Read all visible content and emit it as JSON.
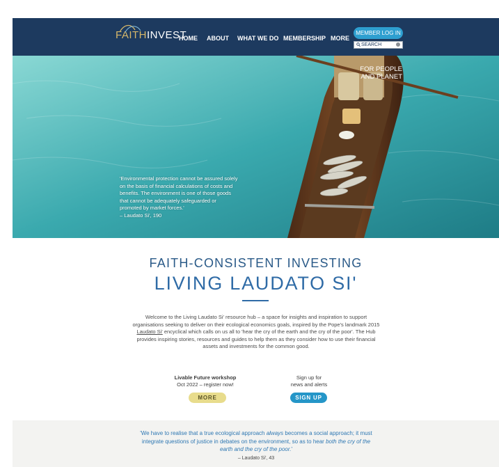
{
  "header": {
    "logo": {
      "part1": "FAITH",
      "part2": "INVEST"
    },
    "nav": [
      {
        "label": "HOME"
      },
      {
        "label": "ABOUT"
      },
      {
        "label": "WHAT WE DO"
      },
      {
        "label": "MEMBERSHIP"
      },
      {
        "label": "MORE"
      }
    ],
    "member_login_label": "MEMBER LOG IN",
    "search_placeholder": "SEARCH"
  },
  "hero": {
    "tagline_line1": "FOR PEOPLE",
    "tagline_line2": "AND PLANET",
    "quote_text": "'Environmental protection cannot be assured solely on the basis of financial calculations of costs and benefits. The environment is one of those goods that cannot be adequately safeguarded or promoted by market forces.'",
    "quote_cite": "– Laudato Si', 190"
  },
  "main": {
    "kicker": "FAITH-CONSISTENT INVESTING",
    "title": "LIVING LAUDATO SI'",
    "intro_before": "Welcome to the Living Laudato Si' resource hub – a space for insights and inspiration to support organisations seeking to deliver on their ecological economics goals, inspired by the Pope's landmark 2015 ",
    "intro_link": "Laudato Si'",
    "intro_after": " encyclical which calls on us all to 'hear the cry of the earth and the cry of the poor'. The Hub provides inspiring stories, resources and guides to help them as they consider how to use their financial assets and investments for the common good."
  },
  "cta": {
    "left_line1": "Livable Future workshop",
    "left_line2": "Oct 2022 – register now!",
    "left_button": "MORE",
    "right_line1": "Sign up for",
    "right_line2": "news and alerts",
    "right_button": "SIGN UP"
  },
  "footer_quote": {
    "part1": "'We have to realise that a true ecological approach ",
    "em1": "always",
    "part2": " becomes a social approach; it must integrate questions of justice in debates on the environment, so as to hear ",
    "em2": "both the cry of the earth and the cry of the poor.",
    "part3": "'",
    "cite": "– Laudato Si', 43"
  },
  "colors": {
    "header_bg": "#1d3a5f",
    "accent_blue": "#2596c8",
    "button_yellow": "#e8dc8c",
    "title_blue": "#2f6ba6",
    "logo_gold": "#d7b769"
  }
}
